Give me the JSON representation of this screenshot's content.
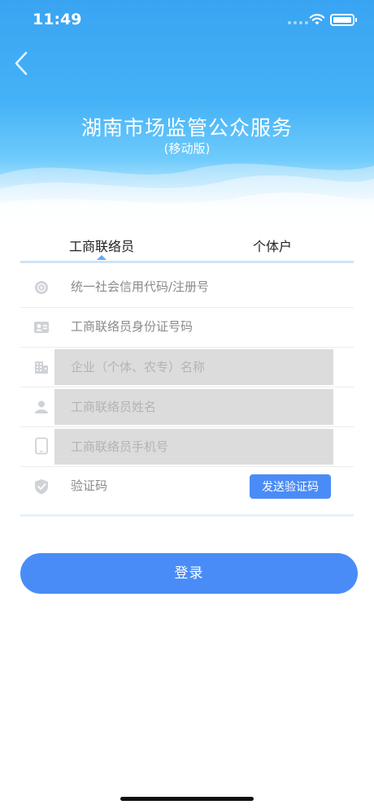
{
  "status_bar": {
    "time": "11:49"
  },
  "header": {
    "title": "湖南市场监管公众服务",
    "subtitle": "(移动版)"
  },
  "tabs": [
    {
      "label": "工商联络员",
      "active": true
    },
    {
      "label": "个体户",
      "active": false
    }
  ],
  "form": {
    "credit_code": {
      "placeholder": "统一社会信用代码/注册号",
      "icon": "badge-icon"
    },
    "id_number": {
      "placeholder": "工商联络员身份证号码",
      "icon": "id-card-icon"
    },
    "company_name": {
      "placeholder": "企业（个体、农专）名称",
      "icon": "building-icon"
    },
    "contact_name": {
      "placeholder": "工商联络员姓名",
      "icon": "person-icon"
    },
    "phone": {
      "placeholder": "工商联络员手机号",
      "icon": "phone-icon"
    },
    "verification": {
      "placeholder": "验证码",
      "icon": "shield-icon",
      "send_label": "发送验证码"
    }
  },
  "login": {
    "label": "登录"
  },
  "colors": {
    "primary": "#4a8cf7",
    "header_top": "#39a4f2",
    "disabled_field": "#dcdcdc"
  }
}
